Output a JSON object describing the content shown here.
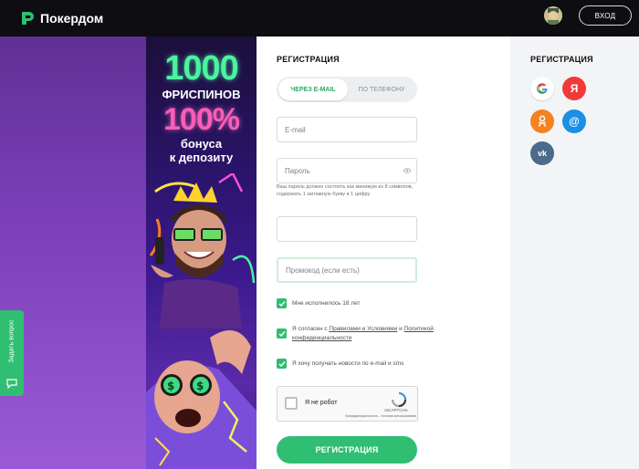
{
  "header": {
    "brand_name": "Покердом",
    "login_label": "ВХОД"
  },
  "help_tab": {
    "label": "Задать вопрос"
  },
  "banner": {
    "line1": "1000",
    "line2": "ФРИСПИНОВ",
    "line3": "100%",
    "line4a": "бонуса",
    "line4b": "к депозиту"
  },
  "form": {
    "title": "РЕГИСТРАЦИЯ",
    "tabs": [
      {
        "label": "ЧЕРЕЗ E-MAIL",
        "active": true
      },
      {
        "label": "ПО ТЕЛЕФОНУ",
        "active": false
      }
    ],
    "email_placeholder": "E-mail",
    "password_placeholder": "Пароль",
    "password_hint": "Ваш пароль должен состоять как минимум из 8 символов, содержать 1 заглавную букву и 1 цифру",
    "extra_field_value": "",
    "promo_placeholder": "Промокод (если есть)",
    "checkbox_age": "Мне исполнилось 18 лет",
    "checkbox_terms_pre": "Я согласен с ",
    "checkbox_terms_link1": "Правилами и Условиями",
    "checkbox_terms_mid": " и ",
    "checkbox_terms_link2": "Политикой конфиденциальности",
    "checkbox_news": "Я хочу получать новости по e-mail и sms",
    "captcha_label": "Я не робот",
    "captcha_brand": "reCAPTCHA",
    "captcha_privacy": "Конфиденциальность - Условия использования",
    "submit_label": "РЕГИСТРАЦИЯ"
  },
  "social": {
    "title": "РЕГИСТРАЦИЯ",
    "buttons": [
      {
        "name": "google",
        "glyph": "G",
        "color": "#ffffff"
      },
      {
        "name": "yandex",
        "glyph": "Я",
        "color": "#f03a3a"
      },
      {
        "name": "odnoklassniki",
        "glyph": "ок",
        "color": "#f58220"
      },
      {
        "name": "mail",
        "glyph": "@",
        "color": "#1a8fe3"
      },
      {
        "name": "vk",
        "glyph": "vk",
        "color": "#4c6a8a"
      }
    ]
  },
  "colors": {
    "accent": "#2fbe72",
    "topbar": "#0d0d12"
  }
}
